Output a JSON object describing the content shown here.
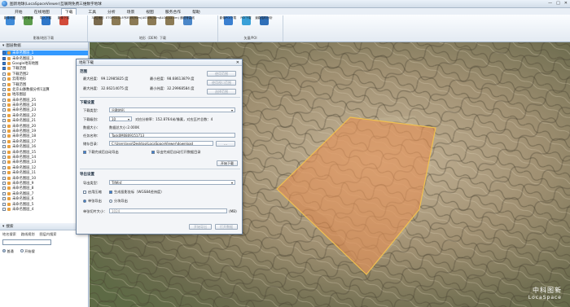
{
  "window": {
    "title": "图新地球(LocaSpaceViewer)互联网免费三维数字地球",
    "controls": [
      "—",
      "□",
      "✕"
    ]
  },
  "menu": [
    "开始",
    "在线地图",
    "下载",
    "工具",
    "分析",
    "场景",
    "视图",
    "服务合作",
    "帮助"
  ],
  "ribbon": {
    "groups": [
      {
        "name": "影像/地形下载",
        "items": [
          {
            "label": "影像地图",
            "icon": "map-icon",
            "color": "#3f8ad8"
          },
          {
            "label": "历史影像",
            "icon": "history-icon",
            "color": "#5a9a4a"
          },
          {
            "label": "导入下载",
            "icon": "import-icon",
            "color": "#2f77c9"
          },
          {
            "label": "影像下载",
            "icon": "download-icon",
            "color": "#d24b3a"
          }
        ]
      },
      {
        "name": "地形（DEM）下载",
        "items": [
          {
            "label": "32位地形",
            "icon": "terrain-icon",
            "color": "#7a6a4e"
          },
          {
            "label": "ETOPO1(1.8千m)",
            "icon": "terrain-icon",
            "color": "#8b7a55"
          },
          {
            "label": "SRTM(90m)",
            "icon": "terrain-icon",
            "color": "#8b7a55"
          },
          {
            "label": "ASTER(30m)",
            "icon": "terrain-icon",
            "color": "#8b7a55"
          },
          {
            "label": "ALOS(12.5m)",
            "icon": "terrain-icon",
            "color": "#8b7a55"
          },
          {
            "label": "通视等高线",
            "icon": "contour-icon",
            "color": "#4a86c8"
          }
        ]
      },
      {
        "name": "矢量/POI",
        "items": [
          {
            "label": "影像POI下载",
            "icon": "poi-icon",
            "color": "#3a7fd0"
          },
          {
            "label": "POI下载",
            "icon": "poi-icon",
            "color": "#39a0d8"
          },
          {
            "label": "道路结构分析",
            "icon": "road-icon",
            "color": "#2f6fb8"
          }
        ]
      }
    ]
  },
  "layers": {
    "title": "图层数据",
    "items": [
      {
        "label": "未命名图层_1",
        "checked": true,
        "selected": true
      },
      {
        "label": "未命名图层_1",
        "checked": true,
        "selected": false
      },
      {
        "label": "Google地形地图",
        "checked": true,
        "selected": false
      },
      {
        "label": "下载范围",
        "checked": true,
        "selected": false
      },
      {
        "label": "下载范围2",
        "checked": false,
        "selected": false
      },
      {
        "label": "云南地形",
        "checked": false,
        "selected": false
      },
      {
        "label": "下载范围",
        "checked": false,
        "selected": false
      },
      {
        "label": "北京山脉数据分析1运算",
        "checked": false,
        "selected": false
      },
      {
        "label": "地形图层",
        "checked": false,
        "selected": false
      },
      {
        "label": "未命名图层_25",
        "checked": false,
        "selected": false
      },
      {
        "label": "未命名图层_24",
        "checked": false,
        "selected": false
      },
      {
        "label": "未命名图层_23",
        "checked": false,
        "selected": false
      },
      {
        "label": "未命名图层_22",
        "checked": false,
        "selected": false
      },
      {
        "label": "未命名图层_21",
        "checked": false,
        "selected": false
      },
      {
        "label": "未命名图层_20",
        "checked": false,
        "selected": false
      },
      {
        "label": "未命名图层_19",
        "checked": false,
        "selected": false
      },
      {
        "label": "未命名图层_18",
        "checked": false,
        "selected": false
      },
      {
        "label": "未命名图层_17",
        "checked": false,
        "selected": false
      },
      {
        "label": "未命名图层_16",
        "checked": false,
        "selected": false
      },
      {
        "label": "未命名图层_15",
        "checked": false,
        "selected": false
      },
      {
        "label": "未命名图层_14",
        "checked": false,
        "selected": false
      },
      {
        "label": "未命名图层_13",
        "checked": false,
        "selected": false
      },
      {
        "label": "未命名图层_12",
        "checked": false,
        "selected": false
      },
      {
        "label": "未命名图层_11",
        "checked": false,
        "selected": false
      },
      {
        "label": "未命名图层_10",
        "checked": false,
        "selected": false
      },
      {
        "label": "未命名图层_9",
        "checked": false,
        "selected": false
      },
      {
        "label": "未命名图层_8",
        "checked": false,
        "selected": false
      },
      {
        "label": "未命名图层_7",
        "checked": false,
        "selected": false
      },
      {
        "label": "未命名图层_6",
        "checked": false,
        "selected": false
      },
      {
        "label": "未命名图层_5",
        "checked": false,
        "selected": false
      },
      {
        "label": "未命名图层_4",
        "checked": false,
        "selected": false
      }
    ]
  },
  "search": {
    "title": "搜索",
    "tabs": [
      "地名搜索",
      "路线规划",
      "图层内搜索"
    ],
    "placeholder": "",
    "options": [
      "普通",
      "开始搜"
    ]
  },
  "dialog": {
    "title": "地形下载",
    "close": "✕",
    "range": {
      "section": "范围",
      "max_lon_label": "最大经度:",
      "max_lon": "99.12985825 度",
      "min_lon_label": "最小经度:",
      "min_lon": "98.68613879 度",
      "max_lat_label": "最大纬度:",
      "max_lat": "32.66214075 度",
      "min_lat_label": "最小纬度:",
      "min_lat": "32.29968584 度",
      "buttons": [
        "使用范围",
        "使用视口范围",
        "选择范围"
      ]
    },
    "download": {
      "section": "下载设置",
      "type_label": "下载类型：",
      "type_value": "谷歌地形",
      "level_label": "下载级别：",
      "level_value": "10",
      "level_info": "对应分辨率：152.8764米/像素，对应瓦片总数：4",
      "size_label": "数据大小：",
      "size_value": "数据总大小:2.000K",
      "task_label": "任务名称：",
      "task_value": "Task0M0809151713",
      "dir_label": "储存目录：",
      "dir_value": "C:\\Users\\xxx\\Desktop\\LocaSpaceViewer\\download",
      "browse": "...",
      "opt1": "下载完成后自动导出",
      "opt2": "导出完成后自动打开数据目录",
      "start": "开始下载"
    },
    "export": {
      "section": "导出设置",
      "type_label": "导出类型：",
      "type_value": "Tif格式",
      "opt_a": "启用压缩",
      "opt_b": "生成投影坐标（WGS84经纬度）",
      "single": "单张导出",
      "split": "分块导出",
      "size_label": "单张切片大小：",
      "size_value": "1024",
      "size_unit": "(MB)",
      "buttons": [
        "开始导出",
        "打开数据"
      ]
    }
  },
  "watermark": {
    "cn": "中科图新",
    "en": "LocaSpace"
  },
  "colors": {
    "selection": "#3399ff",
    "polygon_fill": "#e8884a",
    "polygon_stroke": "#f0c050"
  }
}
